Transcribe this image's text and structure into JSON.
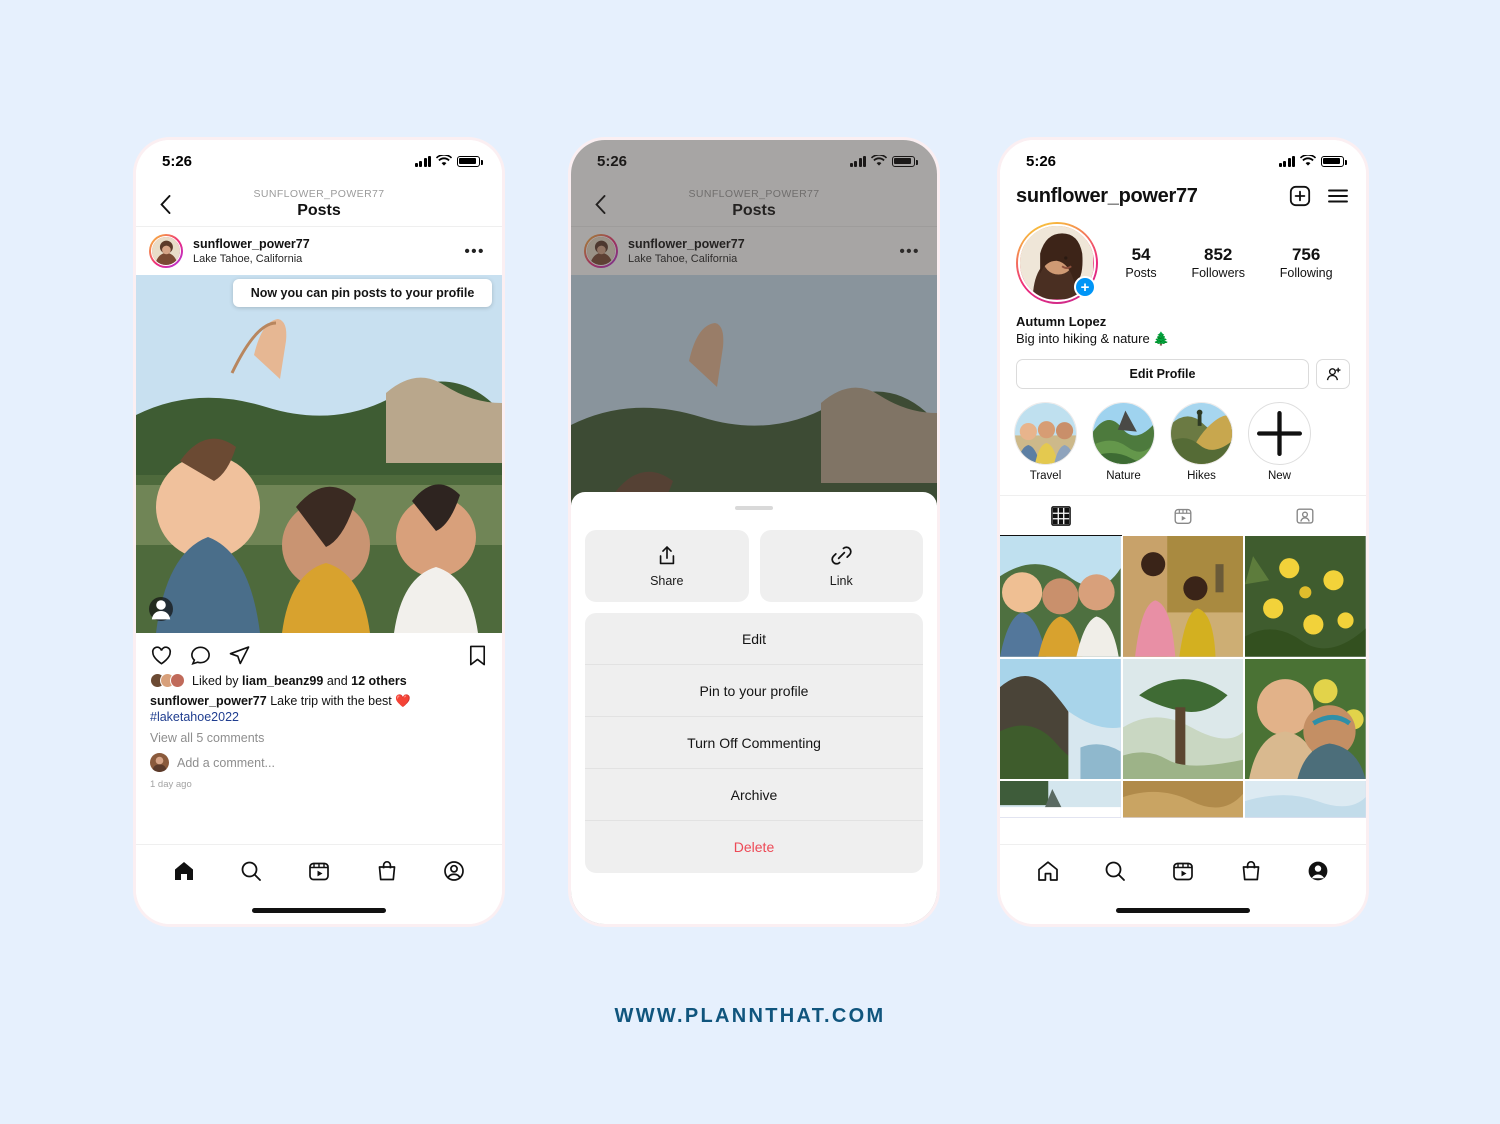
{
  "page": {
    "background_color": "#e6f0fd",
    "footer_text": "WWW.PLANNTHAT.COM",
    "footer_color": "#10557d"
  },
  "status_bar": {
    "time": "5:26"
  },
  "phone1": {
    "nav": {
      "subtitle": "SUNFLOWER_POWER77",
      "title": "Posts",
      "back_icon": "chevron-left-icon"
    },
    "post": {
      "author": "sunflower_power77",
      "location": "Lake Tahoe, California",
      "more_icon": "more-options-icon",
      "tooltip": "Now you can pin posts to your profile",
      "tag_icon": "tagged-people-icon",
      "actions": [
        "heart-icon",
        "comment-icon",
        "share-icon",
        "bookmark-icon"
      ],
      "liked_by_prefix": "Liked by",
      "liked_by_user": "liam_beanz99",
      "liked_by_mid": "and",
      "liked_by_count": "12 others",
      "caption_user": "sunflower_power77",
      "caption_text": "Lake trip with the best ❤️",
      "caption_hashtag": "#laketahoe2022",
      "view_comments": "View all 5 comments",
      "add_comment_placeholder": "Add a comment...",
      "time_ago": "1 day ago"
    },
    "tabbar": [
      "home-icon",
      "search-icon",
      "reels-icon",
      "shop-icon",
      "profile-icon"
    ]
  },
  "phone2": {
    "nav": {
      "subtitle": "SUNFLOWER_POWER77",
      "title": "Posts",
      "back_icon": "chevron-left-icon"
    },
    "post": {
      "author": "sunflower_power77",
      "location": "Lake Tahoe, California",
      "more_icon": "more-options-icon"
    },
    "sheet": {
      "share_label": "Share",
      "share_icon": "share-up-icon",
      "link_label": "Link",
      "link_icon": "link-icon",
      "items": [
        {
          "label": "Edit",
          "style": "normal"
        },
        {
          "label": "Pin to your profile",
          "style": "normal"
        },
        {
          "label": "Turn Off Commenting",
          "style": "normal"
        },
        {
          "label": "Archive",
          "style": "normal"
        },
        {
          "label": "Delete",
          "style": "danger"
        }
      ],
      "danger_color": "#ed4956"
    }
  },
  "phone3": {
    "header": {
      "username": "sunflower_power77",
      "add_icon": "plus-box-icon",
      "menu_icon": "hamburger-menu-icon"
    },
    "avatar": {
      "story_badge": "+",
      "badge_color": "#0095f6"
    },
    "stats": [
      {
        "number": "54",
        "label": "Posts"
      },
      {
        "number": "852",
        "label": "Followers"
      },
      {
        "number": "756",
        "label": "Following"
      }
    ],
    "bio": {
      "name": "Autumn Lopez",
      "description": "Big into hiking & nature 🌲"
    },
    "buttons": {
      "edit_profile": "Edit Profile",
      "add_person_icon": "add-person-icon"
    },
    "highlights": [
      {
        "label": "Travel",
        "type": "image"
      },
      {
        "label": "Nature",
        "type": "image"
      },
      {
        "label": "Hikes",
        "type": "image"
      },
      {
        "label": "New",
        "type": "new"
      }
    ],
    "tabs": [
      {
        "icon": "grid-icon",
        "active": true
      },
      {
        "icon": "reels-icon",
        "active": false
      },
      {
        "icon": "tagged-icon",
        "active": false
      }
    ],
    "tabbar": [
      "home-icon",
      "search-icon",
      "reels-icon",
      "shop-icon",
      "profile-icon-filled"
    ]
  }
}
